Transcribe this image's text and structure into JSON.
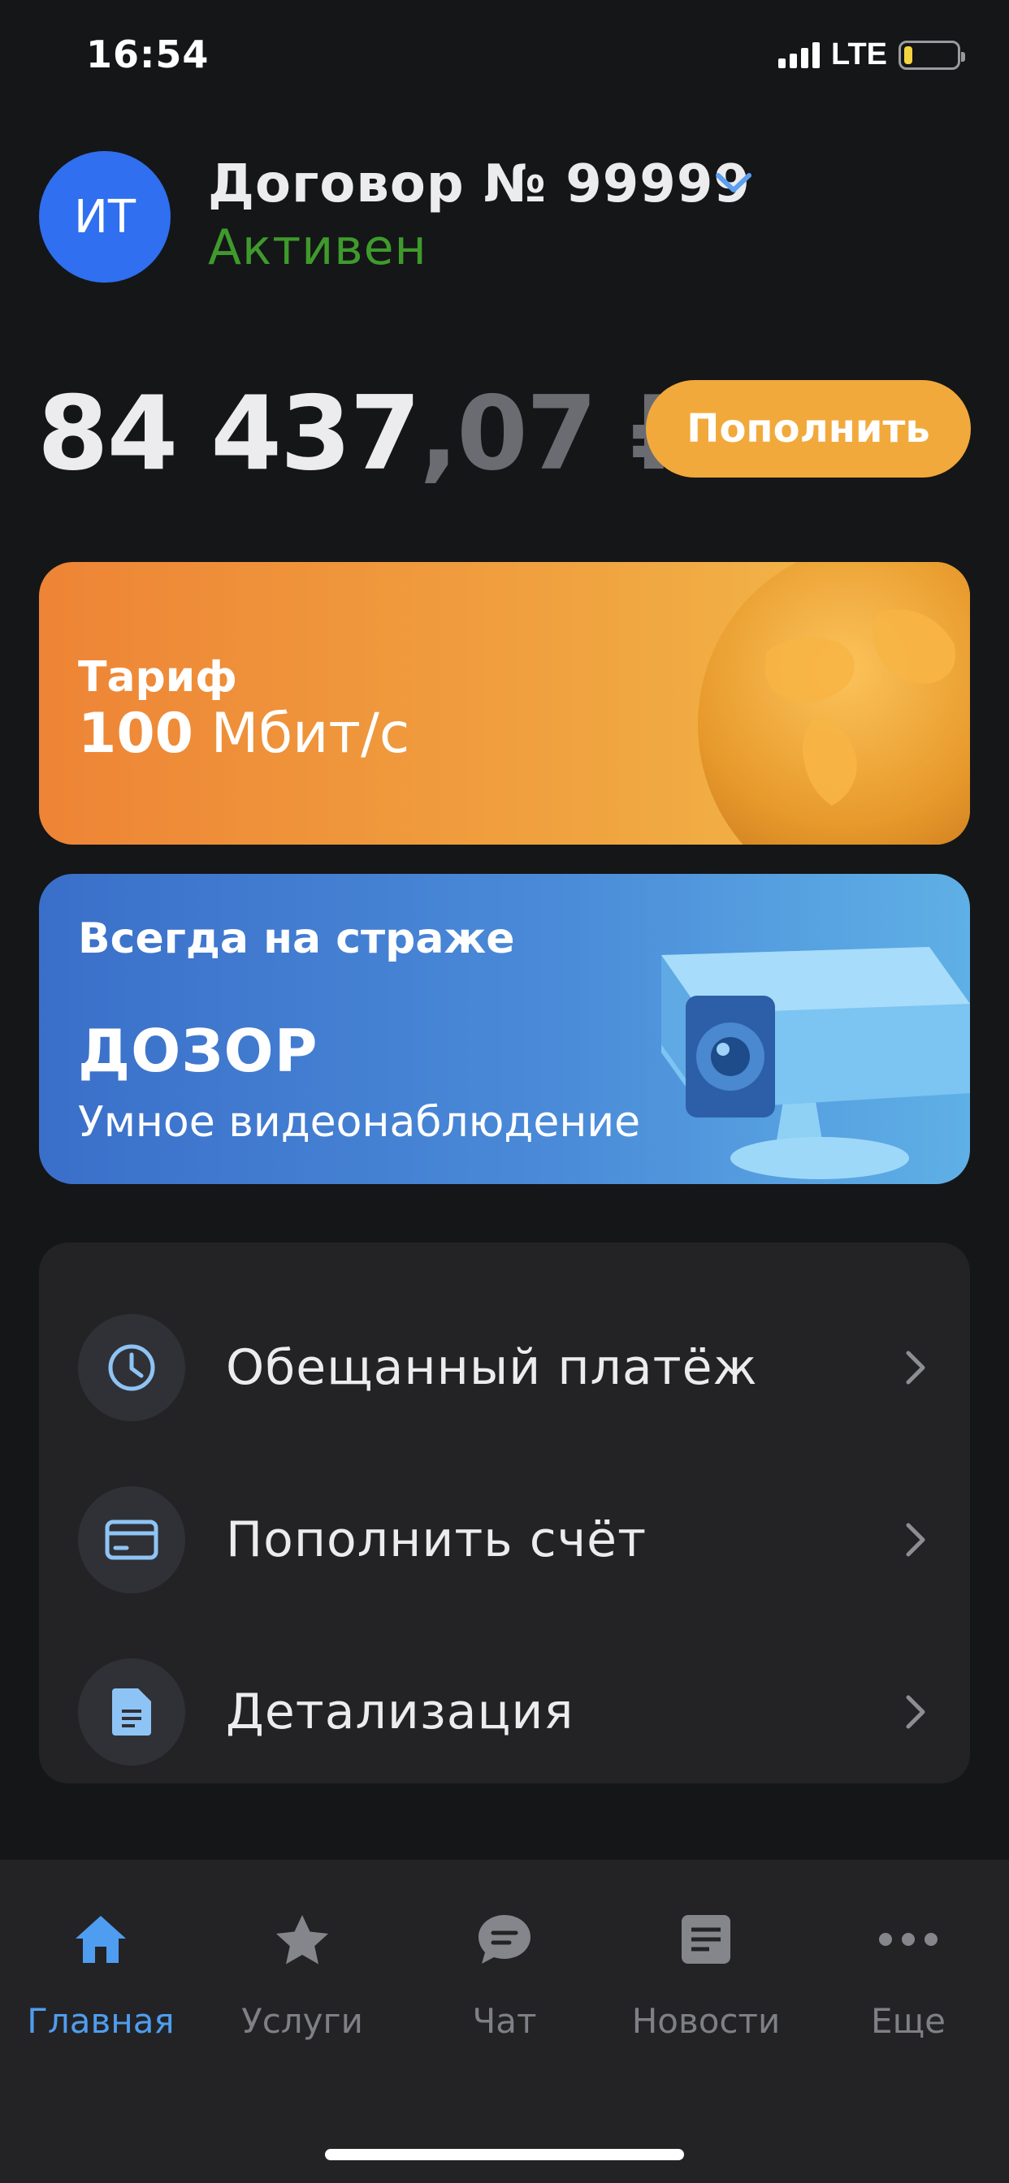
{
  "status_bar": {
    "time": "16:54",
    "network": "LTE",
    "battery_level": 0.15,
    "icons": [
      "signal-icon",
      "battery-icon"
    ]
  },
  "account": {
    "avatar_initials": "ИТ",
    "contract_title": "Договор № 99999",
    "status": "Активен",
    "status_color": "#3f9a2c"
  },
  "balance": {
    "integer": "84 437",
    "fraction": ",07 ₽",
    "topup_label": "Пополнить",
    "accent_color": "#f2a93b"
  },
  "tariff_card": {
    "label": "Тариф",
    "speed_value": "100",
    "speed_unit": "Мбит/с"
  },
  "dozor_card": {
    "tagline": "Всегда на страже",
    "title": "ДОЗОР",
    "subtitle": "Умное видеонаблюдение"
  },
  "menu": {
    "items": [
      {
        "label": "Обещанный платёж",
        "icon": "clock-icon"
      },
      {
        "label": "Пополнить счёт",
        "icon": "credit-card-icon"
      },
      {
        "label": "Детализация",
        "icon": "document-icon"
      }
    ]
  },
  "nav": {
    "items": [
      {
        "label": "Главная",
        "icon": "home-icon",
        "active": true
      },
      {
        "label": "Услуги",
        "icon": "star-icon",
        "active": false
      },
      {
        "label": "Чат",
        "icon": "chat-icon",
        "active": false
      },
      {
        "label": "Новости",
        "icon": "news-icon",
        "active": false
      },
      {
        "label": "Еще",
        "icon": "more-icon",
        "active": false
      }
    ],
    "active_color": "#4f9df0"
  }
}
